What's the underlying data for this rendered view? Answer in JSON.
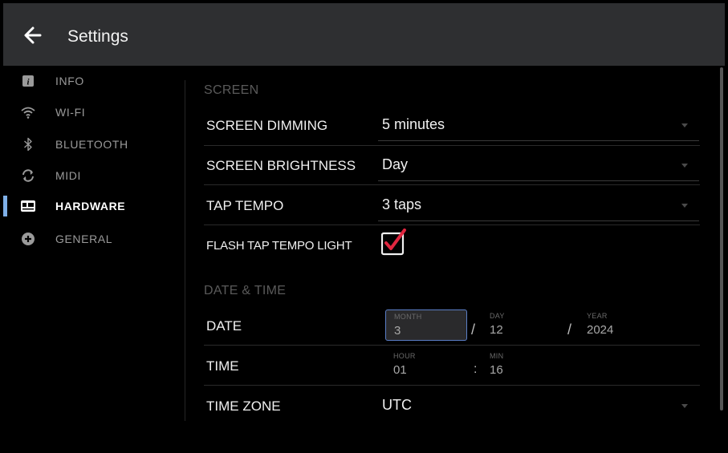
{
  "header": {
    "title": "Settings",
    "back_icon": "arrow-left-icon"
  },
  "sidebar": {
    "items": [
      {
        "label": "INFO",
        "icon": "info-icon"
      },
      {
        "label": "WI-FI",
        "icon": "wifi-icon"
      },
      {
        "label": "BLUETOOTH",
        "icon": "bluetooth-icon"
      },
      {
        "label": "MIDI",
        "icon": "sync-icon"
      },
      {
        "label": "HARDWARE",
        "icon": "hardware-icon",
        "active": true
      },
      {
        "label": "GENERAL",
        "icon": "plus-circle-icon"
      }
    ]
  },
  "screen": {
    "section_title": "SCREEN",
    "dimming": {
      "label": "SCREEN DIMMING",
      "value": "5 minutes"
    },
    "brightness": {
      "label": "SCREEN BRIGHTNESS",
      "value": "Day"
    },
    "tap_tempo": {
      "label": "TAP TEMPO",
      "value": "3 taps"
    },
    "flash_light": {
      "label": "FLASH TAP TEMPO LIGHT",
      "checked": true
    }
  },
  "datetime": {
    "section_title": "DATE & TIME",
    "date": {
      "label": "DATE",
      "month_caption": "MONTH",
      "month": "3",
      "day_caption": "DAY",
      "day": "12",
      "year_caption": "YEAR",
      "year": "2024",
      "separator": "/"
    },
    "time": {
      "label": "TIME",
      "hour_caption": "HOUR",
      "hour": "01",
      "min_caption": "MIN",
      "min": "16",
      "separator": ":"
    },
    "timezone": {
      "label": "TIME ZONE",
      "value": "UTC"
    }
  },
  "colors": {
    "accent": "#7fb0e8",
    "check": "#e0263f",
    "topbar": "#2e2f31"
  }
}
